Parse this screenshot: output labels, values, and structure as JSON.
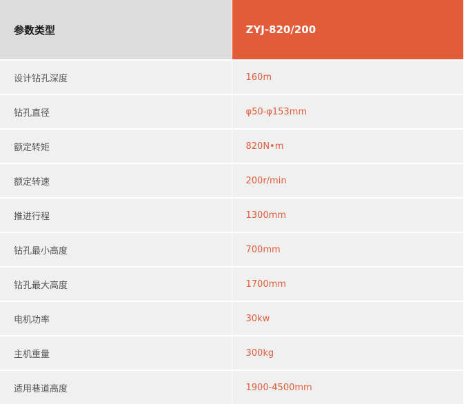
{
  "header": {
    "label": "参数类型",
    "model": "ZYJ-820/200"
  },
  "rows": [
    {
      "label": "设计钻孔深度",
      "value": "160m"
    },
    {
      "label": "钻孔直径",
      "value": "φ50-φ153mm"
    },
    {
      "label": "额定转矩",
      "value": "820N•m"
    },
    {
      "label": "额定转速",
      "value": "200r/min"
    },
    {
      "label": "推进行程",
      "value": "1300mm"
    },
    {
      "label": "钻孔最小高度",
      "value": "700mm"
    },
    {
      "label": "钻孔最大高度",
      "value": "1700mm"
    },
    {
      "label": "电机功率",
      "value": "30kw"
    },
    {
      "label": "主机重量",
      "value": "300kg"
    },
    {
      "label": "适用巷道高度",
      "value": "1900-4500mm"
    }
  ],
  "colors": {
    "accent": "#e25c3a",
    "header_gray": "#dcdcdc",
    "row_bg": "#f0f0f0",
    "label_text": "#555555"
  }
}
